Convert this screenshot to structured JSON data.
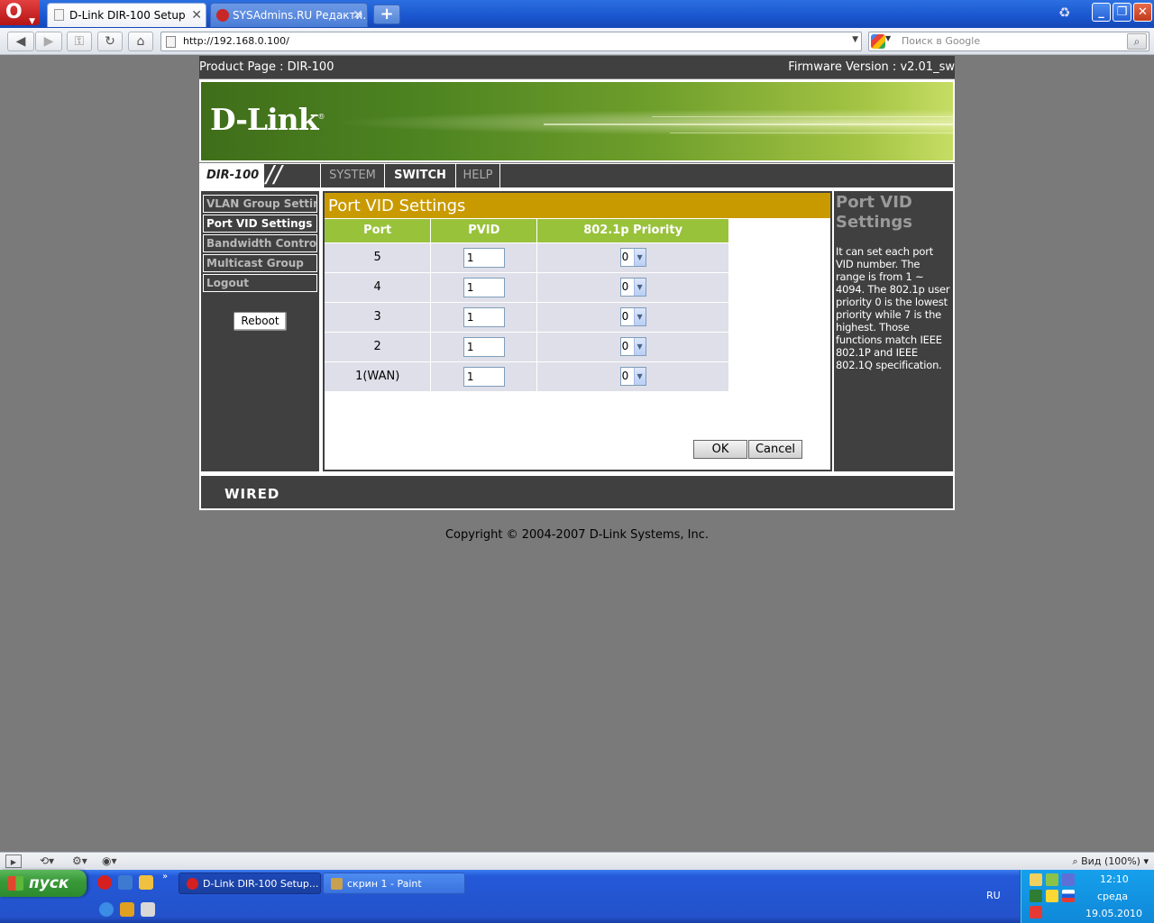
{
  "browser": {
    "menu_button": "O",
    "tabs": [
      {
        "title": "D-Link DIR-100 Setup",
        "close": "✕"
      },
      {
        "title": "SYSAdmins.RU Редакти...",
        "close": "✕"
      }
    ],
    "new_tab": "+",
    "url": "http://192.168.0.100/",
    "search_placeholder": "Поиск в Google",
    "window_buttons": {
      "minimize": "_",
      "maximize": "❐",
      "close": "✕"
    }
  },
  "router": {
    "product_page": "Product Page : DIR-100",
    "firmware": "Firmware Version : v2.01_sw",
    "logo": "D-Link",
    "logo_mark": "®",
    "model": "DIR-100",
    "menu": [
      {
        "label": "SYSTEM",
        "active": false
      },
      {
        "label": "SWITCH",
        "active": true
      },
      {
        "label": "HELP",
        "active": false
      }
    ],
    "sidebar": [
      {
        "label": "VLAN Group Settings",
        "active": false
      },
      {
        "label": "Port VID Settings",
        "active": true
      },
      {
        "label": "Bandwidth Control",
        "active": false
      },
      {
        "label": "Multicast Group",
        "active": false
      },
      {
        "label": "Logout",
        "active": false
      }
    ],
    "reboot_label": "Reboot",
    "section_title": "Port VID Settings",
    "table": {
      "headers": [
        "Port",
        "PVID",
        "802.1p Priority"
      ],
      "rows": [
        {
          "port": "5",
          "pvid": "1",
          "priority": "0"
        },
        {
          "port": "4",
          "pvid": "1",
          "priority": "0"
        },
        {
          "port": "3",
          "pvid": "1",
          "priority": "0"
        },
        {
          "port": "2",
          "pvid": "1",
          "priority": "0"
        },
        {
          "port": "1(WAN)",
          "pvid": "1",
          "priority": "0"
        }
      ]
    },
    "ok_label": "OK",
    "cancel_label": "Cancel",
    "help_title": "Port VID Settings",
    "help_text": "It can set each port VID number. The range is from 1 ~ 4094. The 802.1p user priority 0 is the lowest priority while 7 is the highest. Those functions match IEEE 802.1P and IEEE 802.1Q specification.",
    "footer_brand": "WIRED",
    "copyright": "Copyright © 2004-2007 D-Link Systems, Inc."
  },
  "statusbar": {
    "zoom": "Вид (100%)"
  },
  "taskbar": {
    "start_label": "пуск",
    "tasks": [
      {
        "label": "D-Link DIR-100 Setup...",
        "active": true
      },
      {
        "label": "скрин 1 - Paint",
        "active": false
      }
    ],
    "language": "RU",
    "time": "12:10",
    "day": "среда",
    "date": "19.05.2010"
  },
  "colors": {
    "title_bar": "#1a56cf",
    "router_dark": "#404040",
    "section_header": "#c99a00",
    "table_header": "#99c23b",
    "table_cell": "#dfdfe9"
  }
}
